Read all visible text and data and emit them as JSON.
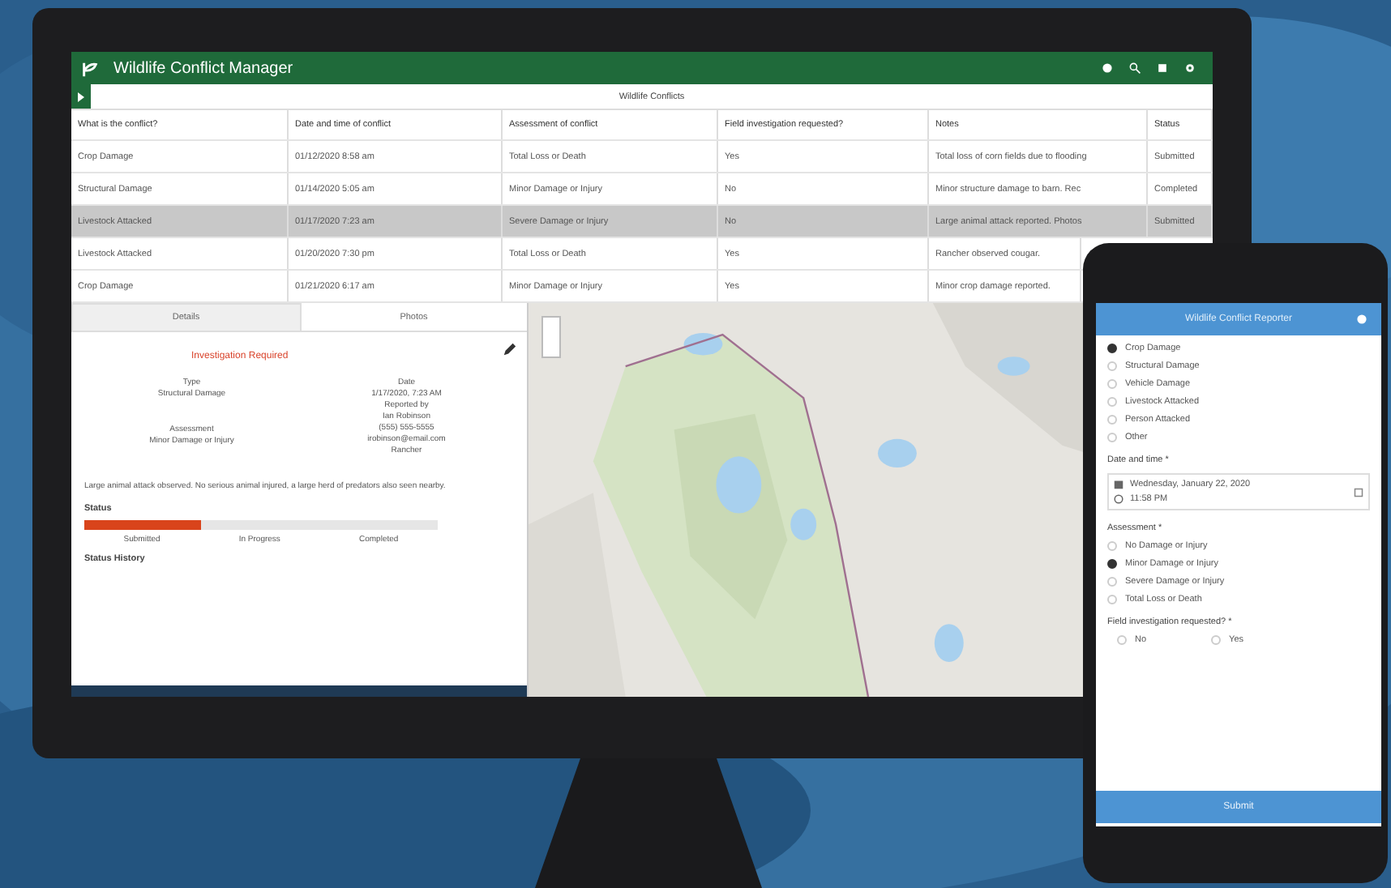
{
  "app": {
    "title": "Wildlife Conflict Manager"
  },
  "table": {
    "title": "Wildlife Conflicts",
    "columns": [
      "What is the conflict?",
      "Date and time of conflict",
      "Assessment of conflict",
      "Field investigation requested?",
      "Notes",
      "Status"
    ],
    "rows": [
      {
        "selected": false,
        "cells": [
          "Crop Damage",
          "01/12/2020 8:58 am",
          "Total Loss or Death",
          "Yes",
          "Total loss of corn fields due to flooding",
          "Submitted"
        ]
      },
      {
        "selected": false,
        "cells": [
          "Structural Damage",
          "01/14/2020 5:05 am",
          "Minor Damage or Injury",
          "No",
          "Minor structure damage to barn. Rec",
          "Completed"
        ]
      },
      {
        "selected": true,
        "cells": [
          "Livestock Attacked",
          "01/17/2020 7:23 am",
          "Severe Damage or Injury",
          "No",
          "Large animal attack reported. Photos",
          "Submitted"
        ]
      },
      {
        "selected": false,
        "cells": [
          "Livestock Attacked",
          "01/20/2020 7:30 pm",
          "Total Loss or Death",
          "Yes",
          "Rancher observed cougar."
        ]
      },
      {
        "selected": false,
        "cells": [
          "Crop Damage",
          "01/21/2020 6:17 am",
          "Minor Damage or Injury",
          "Yes",
          "Minor crop damage reported."
        ]
      }
    ]
  },
  "details": {
    "tabs": [
      {
        "label": "Details",
        "selected": true
      },
      {
        "label": "Photos",
        "selected": false
      }
    ],
    "heading": "Investigation Required",
    "left_fields": [
      {
        "label": "Type",
        "value": "Structural Damage"
      },
      {
        "label": "Assessment",
        "value": "Minor Damage or Injury"
      }
    ],
    "date": {
      "label": "Date",
      "value": "1/17/2020, 7:23 AM"
    },
    "reporter": {
      "label": "Reported by",
      "lines": [
        "Ian Robinson",
        "(555) 555-5555",
        "irobinson@email.com",
        "Rancher"
      ]
    },
    "description": "Large animal attack observed. No serious animal injured, a large herd of predators also seen nearby.",
    "status_label": "Status",
    "status_bar": {
      "level": 0.33
    },
    "steps": [
      "Submitted",
      "In Progress",
      "Completed"
    ],
    "history_label": "Status History"
  },
  "phone": {
    "title": "Wildlife Conflict Reporter",
    "conflict_options": [
      {
        "label": "Crop Damage",
        "selected": true
      },
      {
        "label": "Structural Damage",
        "selected": false
      },
      {
        "label": "Vehicle Damage",
        "selected": false
      },
      {
        "label": "Livestock Attacked",
        "selected": false
      },
      {
        "label": "Person Attacked",
        "selected": false
      },
      {
        "label": "Other",
        "selected": false
      }
    ],
    "date_label": "Date and time *",
    "date_value": "Wednesday, January 22, 2020",
    "time_value": "11:58 PM",
    "assessment_label": "Assessment *",
    "assessment_options": [
      {
        "label": "No Damage or Injury",
        "selected": false
      },
      {
        "label": "Minor Damage or Injury",
        "selected": true
      },
      {
        "label": "Severe Damage or Injury",
        "selected": false
      },
      {
        "label": "Total Loss or Death",
        "selected": false
      }
    ],
    "field_label": "Field investigation requested? *",
    "field_options": [
      {
        "label": "No",
        "selected": false
      },
      {
        "label": "Yes",
        "selected": false
      }
    ],
    "submit": "Submit"
  }
}
